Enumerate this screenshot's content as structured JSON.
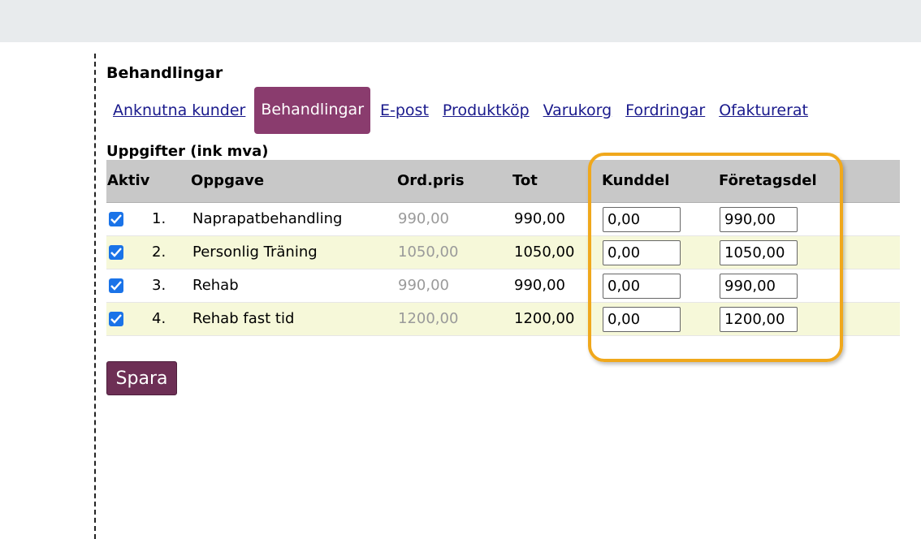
{
  "section": {
    "title": "Behandlingar"
  },
  "tabs": [
    {
      "label": "Anknutna kunder",
      "active": false
    },
    {
      "label": "Behandlingar",
      "active": true
    },
    {
      "label": "E-post",
      "active": false
    },
    {
      "label": "Produktköp",
      "active": false
    },
    {
      "label": "Varukorg",
      "active": false
    },
    {
      "label": "Fordringar",
      "active": false
    },
    {
      "label": "Ofakturerat",
      "active": false
    }
  ],
  "table": {
    "caption": "Uppgifter (ink mva)",
    "headers": {
      "aktiv": "Aktiv",
      "oppgave": "Oppgave",
      "ordpris": "Ord.pris",
      "tot": "Tot",
      "kunddel": "Kunddel",
      "foretagsdel": "Företagsdel"
    },
    "rows": [
      {
        "checked": true,
        "num": "1.",
        "name": "Naprapatbehandling",
        "ordpris": "990,00",
        "tot": "990,00",
        "kunddel": "0,00",
        "foretagsdel": "990,00"
      },
      {
        "checked": true,
        "num": "2.",
        "name": "Personlig Träning",
        "ordpris": "1050,00",
        "tot": "1050,00",
        "kunddel": "0,00",
        "foretagsdel": "1050,00"
      },
      {
        "checked": true,
        "num": "3.",
        "name": "Rehab",
        "ordpris": "990,00",
        "tot": "990,00",
        "kunddel": "0,00",
        "foretagsdel": "990,00"
      },
      {
        "checked": true,
        "num": "4.",
        "name": "Rehab fast tid",
        "ordpris": "1200,00",
        "tot": "1200,00",
        "kunddel": "0,00",
        "foretagsdel": "1200,00"
      }
    ]
  },
  "actions": {
    "save_label": "Spara"
  },
  "colors": {
    "active_tab": "#8a3c6e",
    "save_button": "#6d2f55",
    "highlight": "#f0a81c",
    "row_alt": "#f6f8d9",
    "header_bg": "#c8c8c8"
  }
}
